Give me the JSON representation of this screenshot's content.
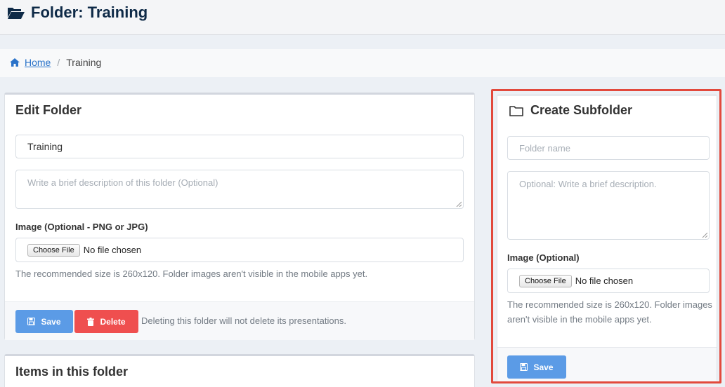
{
  "header": {
    "title": "Folder: Training",
    "icon": "folder-open-icon"
  },
  "breadcrumb": {
    "home": "Home",
    "separator": "/",
    "current": "Training"
  },
  "edit_folder": {
    "title": "Edit Folder",
    "name_value": "Training",
    "description_placeholder": "Write a brief description of this folder (Optional)",
    "image_label": "Image (Optional - PNG or JPG)",
    "choose_file": "Choose File",
    "no_file": "No file chosen",
    "help": "The recommended size is 260x120. Folder images aren't visible in the mobile apps yet.",
    "save_label": "Save",
    "delete_label": "Delete",
    "delete_note": "Deleting this folder will not delete its presentations."
  },
  "create_subfolder": {
    "title": "Create Subfolder",
    "name_placeholder": "Folder name",
    "description_placeholder": "Optional: Write a brief description.",
    "image_label": "Image (Optional)",
    "choose_file": "Choose File",
    "no_file": "No file chosen",
    "help": "The recommended size is 260x120. Folder images aren't visible in the mobile apps yet.",
    "save_label": "Save"
  },
  "items": {
    "title": "Items in this folder"
  },
  "colors": {
    "primary": "#5b9be6",
    "danger": "#ef4f4f",
    "highlight": "#e2493c",
    "title": "#0e2a47",
    "link": "#2a73c9"
  }
}
